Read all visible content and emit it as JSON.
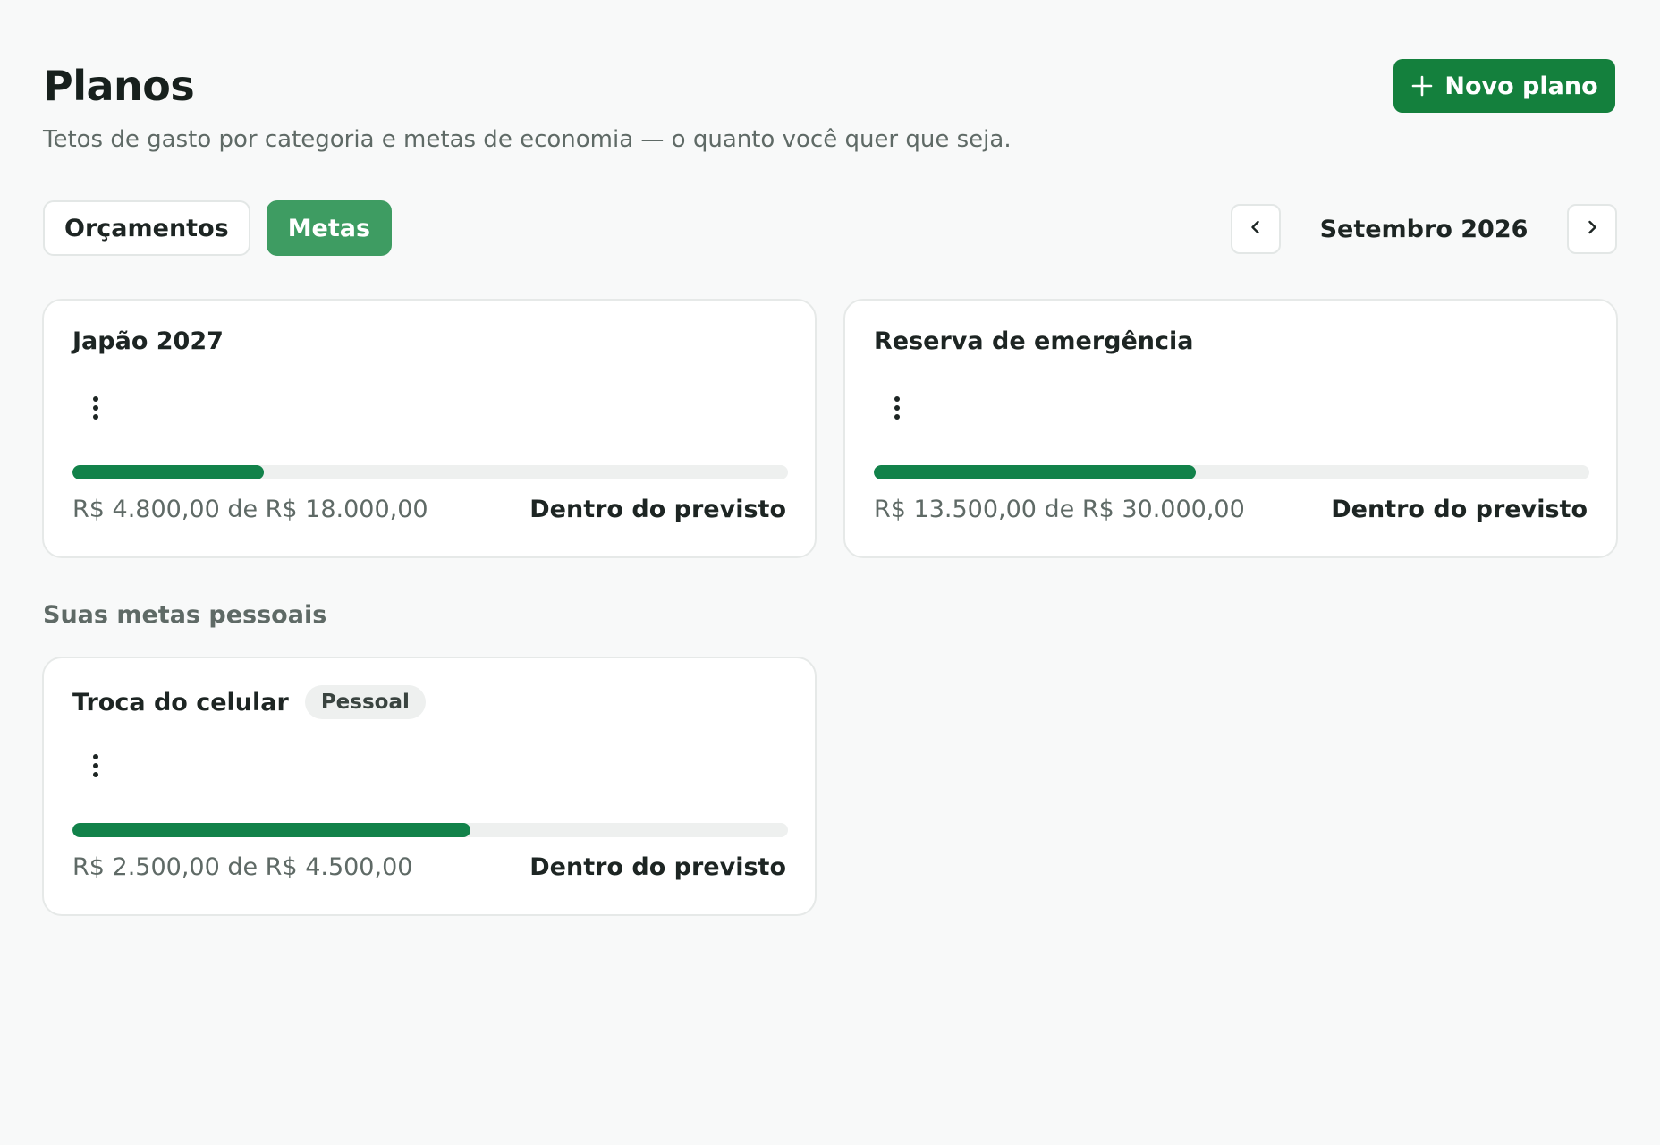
{
  "header": {
    "title": "Planos",
    "subtitle": "Tetos de gasto por categoria e metas de economia — o quanto você quer que seja.",
    "new_plan_label": "Novo plano"
  },
  "tabs": [
    {
      "label": "Orçamentos",
      "active": false
    },
    {
      "label": "Metas",
      "active": true
    }
  ],
  "month_nav": {
    "label": "Setembro 2026"
  },
  "goals": [
    {
      "title": "Japão 2027",
      "amount": "R$ 4.800,00 de R$ 18.000,00",
      "status": "Dentro do previsto",
      "progress": 0.267
    },
    {
      "title": "Reserva de emergência",
      "amount": "R$ 13.500,00 de R$ 30.000,00",
      "status": "Dentro do previsto",
      "progress": 0.45
    }
  ],
  "personal_section": {
    "heading": "Suas metas pessoais",
    "goals": [
      {
        "title": "Troca do celular",
        "badge": "Pessoal",
        "amount": "R$ 2.500,00 de R$ 4.500,00",
        "status": "Dentro do previsto",
        "progress": 0.556
      }
    ]
  },
  "colors": {
    "primary": "#14803d",
    "tab_active": "#3e9c62",
    "progress_fill": "#12824a",
    "progress_track": "#eef0ef",
    "background": "#f8f9f9"
  },
  "icons": {
    "new_plan": "plus-icon",
    "prev": "chevron-left-icon",
    "next": "chevron-right-icon",
    "card_menu": "kebab-menu-icon"
  }
}
